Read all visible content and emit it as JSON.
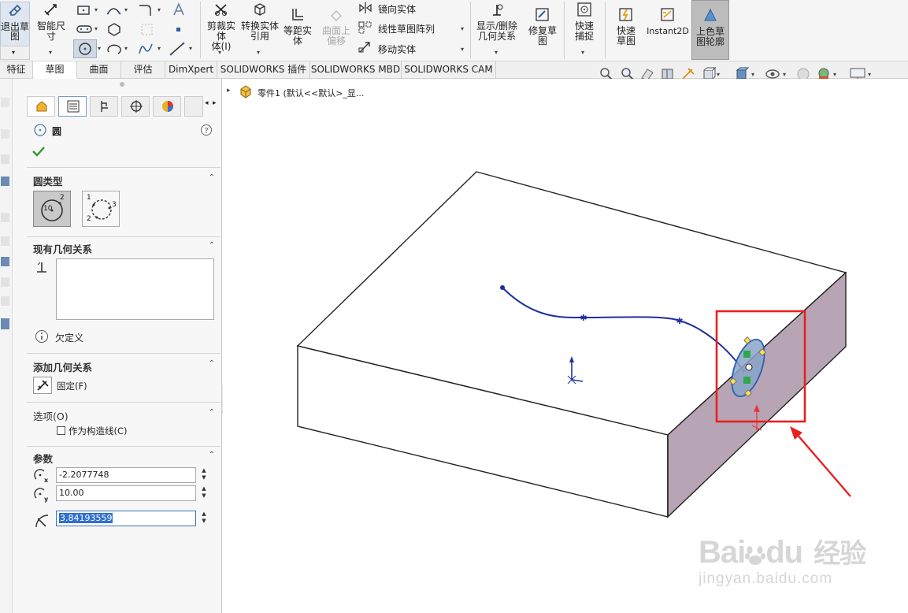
{
  "ribbon": {
    "exit_sketch": "退出草图",
    "smart_dimension": "智能尺寸",
    "trim_entities": "剪裁实体",
    "trim_sub": "体(I)",
    "convert_entities": "转换实体引用",
    "offset_entities": "等距实体",
    "surface_offset": "曲面上偏移",
    "mirror_entities": "镜向实体",
    "linear_pattern": "线性草图阵列",
    "move_entities": "移动实体",
    "display_delete_relations": "显示/删除几何关系",
    "repair_sketch": "修复草图",
    "quick_snaps": "快速捕捉",
    "rapid_sketch": "快速草图",
    "instant2d": "Instant2D",
    "shaded_contours": "上色草图轮廓"
  },
  "tabs": [
    "特征",
    "草图",
    "曲面",
    "评估",
    "DimXpert",
    "SOLIDWORKS 插件",
    "SOLIDWORKS MBD",
    "SOLIDWORKS CAM"
  ],
  "tree_path": "零件1 (默认<<默认>_显...",
  "panel": {
    "title": "圆",
    "circle_type_title": "圆类型",
    "existing_relations_title": "现有几何关系",
    "status": "欠定义",
    "add_relations_title": "添加几何关系",
    "fix_label": "固定(F)",
    "options_title": "选项(O)",
    "construction_label": "作为构造线(C)",
    "params_title": "参数",
    "cx_value": "-2.2077748",
    "cy_value": "10.00",
    "radius_value": "3.84193559",
    "circle_type_center_label": "10",
    "circle_type_center_sub": "2",
    "perimeter_pts": [
      "1",
      "2",
      "3"
    ],
    "subscript_x": "x",
    "subscript_y": "y"
  },
  "watermark": {
    "brand": "Bai",
    "brand_mid": "du",
    "brand_cn": "经验",
    "url": "jingyan.baidu.com"
  },
  "colors": {
    "highlight_box": "#e8211f",
    "spline": "#1f2fa0",
    "side_face": "#b7a4b4",
    "ellipse_fill": "#8aa6c9",
    "accent": "#2e5f9e"
  }
}
